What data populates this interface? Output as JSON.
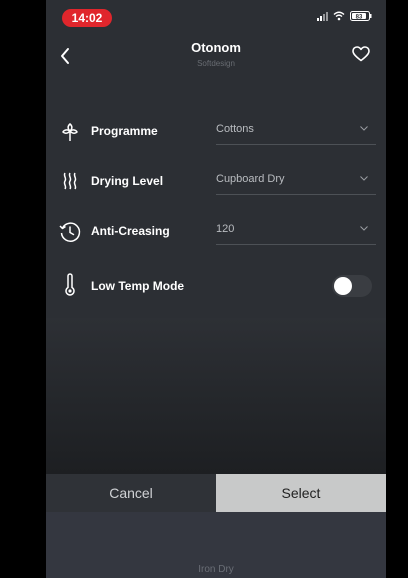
{
  "status_bar": {
    "time": "14:02",
    "battery": "83"
  },
  "header": {
    "title": "Otonom",
    "subtitle": "Softdesign"
  },
  "settings": [
    {
      "label": "Programme",
      "value": "Cottons",
      "icon": "programme-icon"
    },
    {
      "label": "Drying Level",
      "value": "Cupboard Dry",
      "icon": "drying-level-icon"
    },
    {
      "label": "Anti-Creasing",
      "value": "120",
      "icon": "anti-creasing-icon"
    },
    {
      "label": "Low Temp Mode",
      "toggle_on": false,
      "icon": "thermometer-icon"
    }
  ],
  "actions": {
    "cancel": "Cancel",
    "select": "Select"
  },
  "bottom_label": "Iron Dry"
}
